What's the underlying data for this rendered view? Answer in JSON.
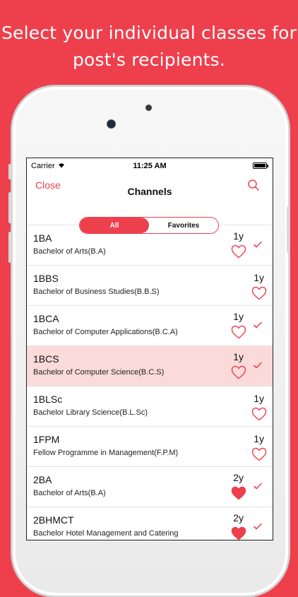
{
  "headline": {
    "line1": "Select your individual classes for",
    "line2": "post's recipients."
  },
  "statusbar": {
    "carrier": "Carrier",
    "time": "11:25 AM"
  },
  "navbar": {
    "close_label": "Close",
    "title": "Channels"
  },
  "segments": {
    "all_label": "All",
    "favorites_label": "Favorites",
    "selected": "All"
  },
  "colors": {
    "accent": "#ee3f4d",
    "selected_row": "#fbdada"
  },
  "channels": [
    {
      "code": "1BA",
      "name": "Bachelor of Arts(B.A)",
      "year": "1y",
      "favorite": false,
      "checked": true,
      "selected": false
    },
    {
      "code": "1BBS",
      "name": "Bachelor of Business Studies(B.B.S)",
      "year": "1y",
      "favorite": false,
      "checked": false,
      "selected": false
    },
    {
      "code": "1BCA",
      "name": "Bachelor of Computer Applications(B.C.A)",
      "year": "1y",
      "favorite": false,
      "checked": true,
      "selected": false
    },
    {
      "code": "1BCS",
      "name": "Bachelor of Computer Science(B.C.S)",
      "year": "1y",
      "favorite": false,
      "checked": true,
      "selected": true
    },
    {
      "code": "1BLSc",
      "name": "Bachelor Library Science(B.L.Sc)",
      "year": "1y",
      "favorite": false,
      "checked": false,
      "selected": false
    },
    {
      "code": "1FPM",
      "name": "Fellow Programme in Management(F.P.M)",
      "year": "1y",
      "favorite": false,
      "checked": false,
      "selected": false
    },
    {
      "code": "2BA",
      "name": "Bachelor of Arts(B.A)",
      "year": "2y",
      "favorite": true,
      "checked": true,
      "selected": false
    },
    {
      "code": "2BHMCT",
      "name": "Bachelor Hotel Management and Catering",
      "year": "2y",
      "favorite": true,
      "checked": true,
      "selected": false
    }
  ]
}
